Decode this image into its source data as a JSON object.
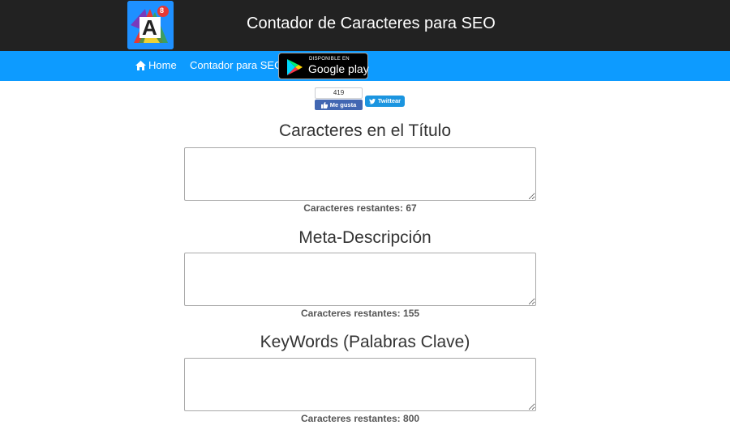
{
  "header": {
    "site_title": "Contador de Caracteres para SEO",
    "logo_icon": "app-logo-a8",
    "logo_letter": "A",
    "logo_badge": "8"
  },
  "nav": {
    "home_label": "Home",
    "home_icon": "home-icon",
    "counter_label": "Contador para SEO",
    "google_play": {
      "small_text": "DISPONIBLE EN",
      "big_text": "Google play",
      "icon": "play-triangle-icon"
    }
  },
  "social": {
    "fb_count": "419",
    "fb_like_label": "Me gusta",
    "twitter_label": "Twittear"
  },
  "sections": [
    {
      "title": "Caracteres en el Título",
      "remaining_label": "Caracteres restantes:",
      "remaining_value": "67",
      "value": ""
    },
    {
      "title": "Meta-Descripción",
      "remaining_label": "Caracteres restantes:",
      "remaining_value": "155",
      "value": ""
    },
    {
      "title": "KeyWords (Palabras Clave)",
      "remaining_label": "Caracteres restantes:",
      "remaining_value": "800",
      "value": ""
    }
  ],
  "colors": {
    "topbar": "#222222",
    "navbar": "#0d9bff",
    "fb": "#4267b2",
    "twitter": "#1b95e0"
  }
}
